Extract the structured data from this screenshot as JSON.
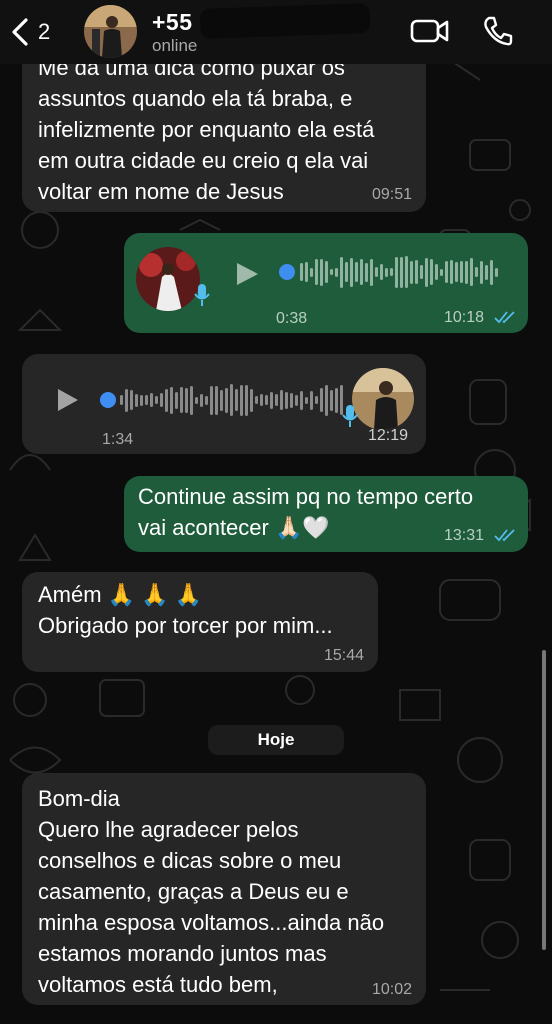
{
  "header": {
    "back_count": "2",
    "contact_name": "+55 51 9 . . . -5 . 40",
    "status": "online"
  },
  "messages": [
    {
      "direction": "incoming",
      "text": "Me da uma dica como puxar os assuntos quando ela tá braba, e infelizmente por enquanto ela está em outra cidade eu creio q ela vai voltar em nome de Jesus",
      "lines": [
        "Me da uma dica como puxar os",
        "assuntos quando ela tá braba, e",
        "infelizmente por enquanto ela está",
        "em outra cidade eu creio q ela vai",
        "voltar em nome de Jesus"
      ],
      "time": "09:51"
    },
    {
      "direction": "outgoing",
      "type": "voice",
      "duration": "0:38",
      "time": "10:18",
      "status": "read"
    },
    {
      "direction": "incoming",
      "type": "voice",
      "duration": "1:34",
      "time": "12:19"
    },
    {
      "direction": "outgoing",
      "lines": [
        "Continue assim pq no tempo certo",
        "vai acontecer 🙏🏻🤍"
      ],
      "time": "13:31",
      "status": "read"
    },
    {
      "direction": "incoming",
      "lines": [
        "Amém 🙏 🙏 🙏",
        "Obrigado por torcer por mim..."
      ],
      "time": "15:44"
    },
    {
      "direction": "incoming",
      "lines": [
        "Bom-dia",
        "Quero lhe agradecer pelos",
        "conselhos e dicas sobre o meu",
        "casamento,  graças a Deus eu e",
        "minha esposa voltamos...ainda não",
        "estamos morando juntos mas",
        "voltamos está tudo bem,"
      ],
      "time": "10:02"
    }
  ],
  "date_separator": "Hoje",
  "colors": {
    "incoming_bubble": "#262626",
    "outgoing_bubble": "#1e5c3b",
    "read_ticks": "#53bdeb",
    "voice_dot": "#3d8ef0"
  },
  "icons": [
    "chevron-left-icon",
    "video-call-icon",
    "phone-icon",
    "play-icon",
    "microphone-icon",
    "double-check-icon"
  ]
}
